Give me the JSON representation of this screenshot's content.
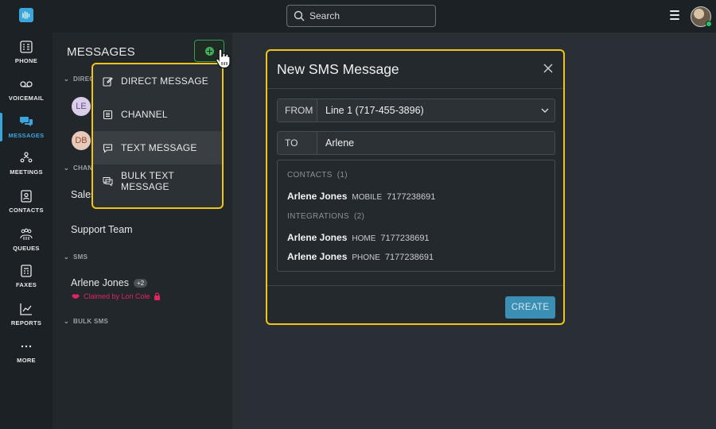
{
  "nav": {
    "items": [
      {
        "label": "PHONE",
        "icon": "phone-grid-icon"
      },
      {
        "label": "VOICEMAIL",
        "icon": "voicemail-icon"
      },
      {
        "label": "MESSAGES",
        "icon": "chat-bubbles-icon",
        "active": true
      },
      {
        "label": "MEETINGS",
        "icon": "people-icon"
      },
      {
        "label": "CONTACTS",
        "icon": "contact-card-icon"
      },
      {
        "label": "QUEUES",
        "icon": "group-icon"
      },
      {
        "label": "FAXES",
        "icon": "fax-icon"
      },
      {
        "label": "REPORTS",
        "icon": "chart-line-icon"
      },
      {
        "label": "MORE",
        "icon": "ellipsis-icon"
      }
    ]
  },
  "header": {
    "search_placeholder": "Search"
  },
  "messages_panel": {
    "title": "MESSAGES",
    "direct_section": "DIRECT",
    "direct_avatars": [
      "LE",
      "DB"
    ],
    "channels_section": "CHAN",
    "channels": [
      "Sales",
      "Support Team"
    ],
    "sms_section": "SMS",
    "sms_item": {
      "name": "Arlene Jones",
      "badge": "+2",
      "claimed": "Claimed by Lori Cole"
    },
    "bulk_section": "BULK SMS"
  },
  "new_menu": {
    "items": [
      {
        "label": "DIRECT MESSAGE",
        "icon": "edit-icon"
      },
      {
        "label": "CHANNEL",
        "icon": "list-icon"
      },
      {
        "label": "TEXT MESSAGE",
        "icon": "sms-icon",
        "highlighted": true
      },
      {
        "label": "BULK TEXT MESSAGE",
        "icon": "bulk-sms-icon"
      }
    ]
  },
  "modal": {
    "title": "New SMS Message",
    "from_label": "FROM",
    "from_value": "Line 1 (717-455-3896)",
    "to_label": "TO",
    "to_value": "Arlene",
    "contacts_header": "CONTACTS",
    "contacts_count": "(1)",
    "contacts": [
      {
        "name": "Arlene Jones",
        "type": "MOBILE",
        "number": "7177238691"
      }
    ],
    "integrations_header": "INTEGRATIONS",
    "integrations_count": "(2)",
    "integrations": [
      {
        "name": "Arlene Jones",
        "type": "HOME",
        "number": "7177238691"
      },
      {
        "name": "Arlene Jones",
        "type": "PHONE",
        "number": "7177238691"
      }
    ],
    "create_label": "CREATE"
  },
  "colors": {
    "accent": "#3aa6dc",
    "highlight_border": "#f2c416",
    "add_green": "#3fae5a",
    "claimed_red": "#e0245e",
    "create_button": "#3b8fb5"
  }
}
